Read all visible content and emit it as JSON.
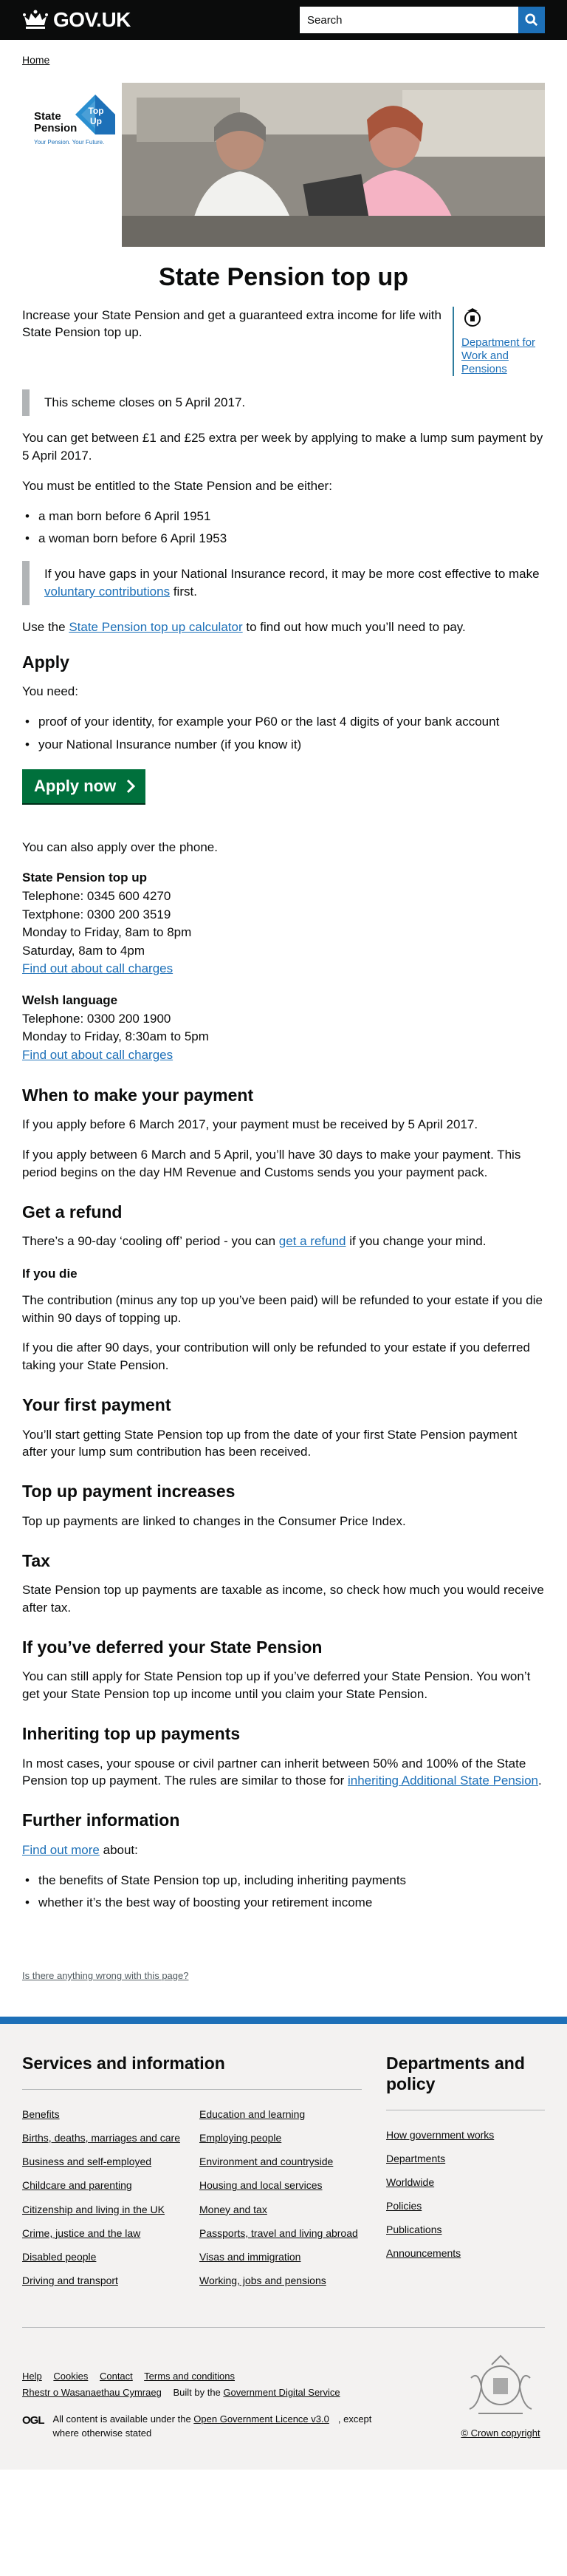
{
  "header": {
    "logo_text": "GOV.UK",
    "search_placeholder": "Search",
    "search_icon": "search-icon"
  },
  "breadcrumb": {
    "home": "Home"
  },
  "hero": {
    "logo_line1": "State",
    "logo_line2": "Pension",
    "badge_text1": "Top",
    "badge_text2": "Up",
    "tagline": "Your Pension. Your Future."
  },
  "page": {
    "title": "State Pension top up",
    "intro": "Increase your State Pension and get a guaranteed extra income for life with State Pension top up.",
    "org": "Department for Work and Pensions",
    "closes": "This scheme closes on 5 April 2017.",
    "extra": "You can get between £1 and £25 extra per week by applying to make a lump sum payment by 5 April 2017.",
    "entitled": "You must be entitled to the State Pension and be either:",
    "eligibility": [
      "a man born before 6 April 1951",
      "a woman born before 6 April 1953"
    ],
    "gaps_pre": "If you have gaps in your National Insurance record, it may be more cost effective to make ",
    "gaps_link": "voluntary contributions",
    "gaps_post": " first.",
    "calc_pre": "Use the ",
    "calc_link": "State Pension top up calculator",
    "calc_post": " to find out how much you’ll need to pay."
  },
  "apply": {
    "heading": "Apply",
    "you_need": "You need:",
    "needs": [
      "proof of your identity, for example your P60 or the last 4 digits of your bank account",
      "your National Insurance number (if you know it)"
    ],
    "button": "Apply now",
    "phone": "You can also apply over the phone."
  },
  "contacts": [
    {
      "title": "State Pension top up",
      "lines": [
        "Telephone: 0345 600 4270",
        "Textphone: 0300 200 3519",
        "Monday to Friday, 8am to 8pm",
        "Saturday, 8am to 4pm"
      ],
      "link": "Find out about call charges"
    },
    {
      "title": "Welsh language",
      "lines": [
        "Telephone: 0300 200 1900",
        "Monday to Friday, 8:30am to 5pm"
      ],
      "link": "Find out about call charges"
    }
  ],
  "sections": {
    "when_heading": "When to make your payment",
    "when_p1": "If you apply before 6 March 2017, your payment must be received by 5 April 2017.",
    "when_p2": "If you apply between 6 March and 5 April, you’ll have 30 days to make your payment. This period begins on the day HM Revenue and Customs sends you your payment pack.",
    "refund_heading": "Get a refund",
    "refund_pre": "There’s a 90-day ‘cooling off’ period - you can ",
    "refund_link": "get a refund",
    "refund_post": " if you change your mind.",
    "die_heading": "If you die",
    "die_p1": "The contribution (minus any top up you’ve been paid) will be refunded to your estate if you die within 90 days of topping up.",
    "die_p2": "If you die after 90 days, your contribution will only be refunded to your estate if you deferred taking your State Pension.",
    "first_heading": "Your first payment",
    "first_p": "You’ll start getting State Pension top up from the date of your first State Pension payment after your lump sum contribution has been received.",
    "increase_heading": "Top up payment increases",
    "increase_p": "Top up payments are linked to changes in the Consumer Price Index.",
    "tax_heading": "Tax",
    "tax_p": "State Pension top up payments are taxable as income, so check how much you would receive after tax.",
    "deferred_heading": "If you’ve deferred your State Pension",
    "deferred_p": "You can still apply for State Pension top up if you’ve deferred your State Pension. You won’t get your State Pension top up income until you claim your State Pension.",
    "inherit_heading": "Inheriting top up payments",
    "inherit_pre": "In most cases, your spouse or civil partner can inherit between 50% and 100% of the State Pension top up payment. The rules are similar to those for ",
    "inherit_link": "inheriting Additional State Pension",
    "inherit_post": ".",
    "further_heading": "Further information",
    "further_link": "Find out more",
    "further_post": " about:",
    "further_items": [
      "the benefits of State Pension top up, including inheriting payments",
      "whether it’s the best way of boosting your retirement income"
    ]
  },
  "feedback": "Is there anything wrong with this page?",
  "footer": {
    "services_heading": "Services and information",
    "services_col1": [
      "Benefits",
      "Births, deaths, marriages and care",
      "Business and self-employed",
      "Childcare and parenting",
      "Citizenship and living in the UK",
      "Crime, justice and the law",
      "Disabled people",
      "Driving and transport"
    ],
    "services_col2": [
      "Education and learning",
      "Employing people",
      "Environment and countryside",
      "Housing and local services",
      "Money and tax",
      "Passports, travel and living abroad",
      "Visas and immigration",
      "Working, jobs and pensions"
    ],
    "departments_heading": "Departments and policy",
    "departments": [
      "How government works",
      "Departments",
      "Worldwide",
      "Policies",
      "Publications",
      "Announcements"
    ],
    "meta": [
      "Help",
      "Cookies",
      "Contact",
      "Terms and conditions"
    ],
    "welsh": "Rhestr o Wasanaethau Cymraeg",
    "built_pre": "Built by the ",
    "built_link": "Government Digital Service",
    "ogl_mark": "OGL",
    "licence_pre": "All content is available under the ",
    "licence_link": "Open Government Licence v3.0",
    "licence_post": ", except where otherwise stated",
    "copyright": "© Crown copyright"
  }
}
